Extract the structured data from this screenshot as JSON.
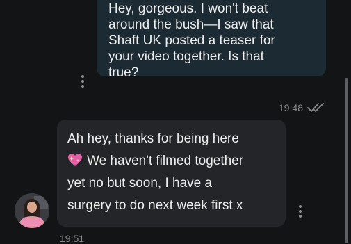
{
  "outgoing_message": {
    "lines": [
      "Hey, gorgeous. I won't beat",
      "around the bush—I saw that",
      "Shaft UK posted a teaser for",
      "your video together. Is that",
      "true?"
    ],
    "time": "19:48",
    "status_icon": "double-check-icon"
  },
  "incoming_message": {
    "lines": [
      "Ah hey, thanks for being here",
      "We haven't filmed together",
      "yet no but soon, I have a",
      "surgery to do next week first x"
    ],
    "emoji": "sparkling-heart-icon",
    "time": "19:51"
  },
  "colors": {
    "background": "#131416",
    "outgoing_bubble": "#1b2a33",
    "incoming_bubble": "#242528",
    "meta_text": "#8a8b8e"
  },
  "icons": [
    "more-options-icon",
    "double-check-icon",
    "sparkling-heart-icon",
    "avatar"
  ]
}
